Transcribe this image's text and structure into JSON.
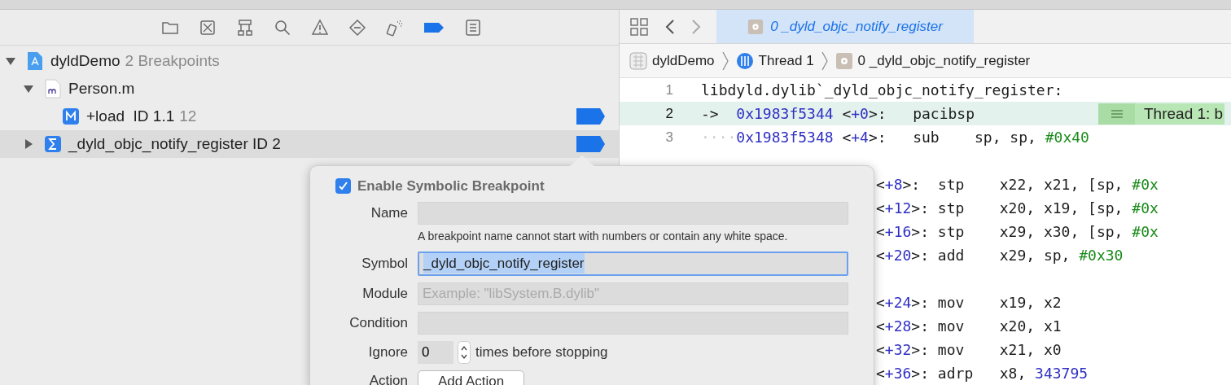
{
  "navigator": {
    "toolbar": [
      {
        "kind": "folder",
        "selected": false
      },
      {
        "kind": "source",
        "selected": false
      },
      {
        "kind": "hierarchy",
        "selected": false
      },
      {
        "kind": "search",
        "selected": false
      },
      {
        "kind": "warning",
        "selected": false
      },
      {
        "kind": "test",
        "selected": false
      },
      {
        "kind": "debug",
        "selected": false
      },
      {
        "kind": "breakpoint",
        "selected": true
      },
      {
        "kind": "report",
        "selected": false
      }
    ],
    "tree": [
      {
        "kind": "project",
        "label": "dyldDemo",
        "detail": "2 Breakpoints",
        "expanded": true,
        "selected": false,
        "children": [
          {
            "kind": "file",
            "label": "Person.m",
            "expanded": true,
            "selected": false,
            "children": [
              {
                "kind": "method",
                "label": "+load  ID 1.1",
                "detail": "12",
                "enabled": true,
                "selected": false
              }
            ]
          },
          {
            "kind": "symbol",
            "label": "_dyld_objc_notify_register ID 2",
            "expanded": false,
            "enabled": true,
            "selected": true
          }
        ]
      }
    ]
  },
  "editor": {
    "tab": {
      "label": "0 _dyld_objc_notify_register",
      "selected": true
    },
    "breadcrumbs": [
      {
        "kind": "project",
        "label": "dyldDemo"
      },
      {
        "kind": "thread",
        "label": "Thread 1"
      },
      {
        "kind": "frame",
        "label": "0 _dyld_objc_notify_register"
      }
    ],
    "lines": [
      {
        "number": "1",
        "current": false,
        "tokens": [
          {
            "kind": "plain",
            "text": "libdyld.dylib`_dyld_objc_notify_register:"
          }
        ]
      },
      {
        "number": "2",
        "current": true,
        "badge": "Thread 1: b",
        "tokens": [
          {
            "kind": "plain",
            "text": "->  "
          },
          {
            "kind": "addr",
            "text": "0x1983f5344"
          },
          {
            "kind": "plain",
            "text": " <"
          },
          {
            "kind": "addr",
            "text": "+0"
          },
          {
            "kind": "plain",
            "text": ">:   pacibsp"
          }
        ]
      },
      {
        "number": "3",
        "current": false,
        "tokens": [
          {
            "kind": "ws",
            "text": "····"
          },
          {
            "kind": "addr",
            "text": "0x1983f5348"
          },
          {
            "kind": "plain",
            "text": " <"
          },
          {
            "kind": "addr",
            "text": "+4"
          },
          {
            "kind": "plain",
            "text": ">:   sub    sp, sp, "
          },
          {
            "kind": "num",
            "text": "#0x40"
          }
        ]
      }
    ],
    "partial_lines": [
      {
        "kind": "blank"
      },
      {
        "kind": "code",
        "tokens": [
          {
            "kind": "plain",
            "text": "<"
          },
          {
            "kind": "addr",
            "text": "+8"
          },
          {
            "kind": "plain",
            "text": ">:  stp    x22, x21, [sp, "
          },
          {
            "kind": "num",
            "text": "#0x"
          }
        ]
      },
      {
        "kind": "code",
        "tokens": [
          {
            "kind": "plain",
            "text": "<"
          },
          {
            "kind": "addr",
            "text": "+12"
          },
          {
            "kind": "plain",
            "text": ">: stp    x20, x19, [sp, "
          },
          {
            "kind": "num",
            "text": "#0x"
          }
        ]
      },
      {
        "kind": "code",
        "tokens": [
          {
            "kind": "plain",
            "text": "<"
          },
          {
            "kind": "addr",
            "text": "+16"
          },
          {
            "kind": "plain",
            "text": ">: stp    x29, x30, [sp, "
          },
          {
            "kind": "num",
            "text": "#0x"
          }
        ]
      },
      {
        "kind": "code",
        "tokens": [
          {
            "kind": "plain",
            "text": "<"
          },
          {
            "kind": "addr",
            "text": "+20"
          },
          {
            "kind": "plain",
            "text": ">: add    x29, sp, "
          },
          {
            "kind": "num",
            "text": "#0x30"
          }
        ]
      },
      {
        "kind": "blank"
      },
      {
        "kind": "code",
        "tokens": [
          {
            "kind": "plain",
            "text": "<"
          },
          {
            "kind": "addr",
            "text": "+24"
          },
          {
            "kind": "plain",
            "text": ">: mov    x19, x2"
          }
        ]
      },
      {
        "kind": "code",
        "tokens": [
          {
            "kind": "plain",
            "text": "<"
          },
          {
            "kind": "addr",
            "text": "+28"
          },
          {
            "kind": "plain",
            "text": ">: mov    x20, x1"
          }
        ]
      },
      {
        "kind": "code",
        "tokens": [
          {
            "kind": "plain",
            "text": "<"
          },
          {
            "kind": "addr",
            "text": "+32"
          },
          {
            "kind": "plain",
            "text": ">: mov    x21, x0"
          }
        ]
      },
      {
        "kind": "code",
        "tokens": [
          {
            "kind": "plain",
            "text": "<"
          },
          {
            "kind": "addr",
            "text": "+36"
          },
          {
            "kind": "plain",
            "text": ">: adrp   x8, "
          },
          {
            "kind": "addr",
            "text": "343795"
          }
        ]
      }
    ]
  },
  "popover": {
    "enable": {
      "label": "Enable Symbolic Breakpoint",
      "checked": true
    },
    "fields": [
      {
        "kind": "text",
        "label": "Name",
        "hint": "A breakpoint name cannot start with numbers or contain any white space.",
        "focused": false
      },
      {
        "kind": "text",
        "label": "Symbol",
        "value": "_dyld_objc_notify_register",
        "focused": true
      },
      {
        "kind": "text",
        "label": "Module",
        "placeholder": "Example: \"libSystem.B.dylib\"",
        "focused": false
      },
      {
        "kind": "text",
        "label": "Condition",
        "focused": false
      },
      {
        "kind": "stepper",
        "label": "Ignore",
        "value": "0",
        "suffix": "times before stopping"
      },
      {
        "kind": "button",
        "label": "Action",
        "button": "Add Action"
      }
    ]
  }
}
